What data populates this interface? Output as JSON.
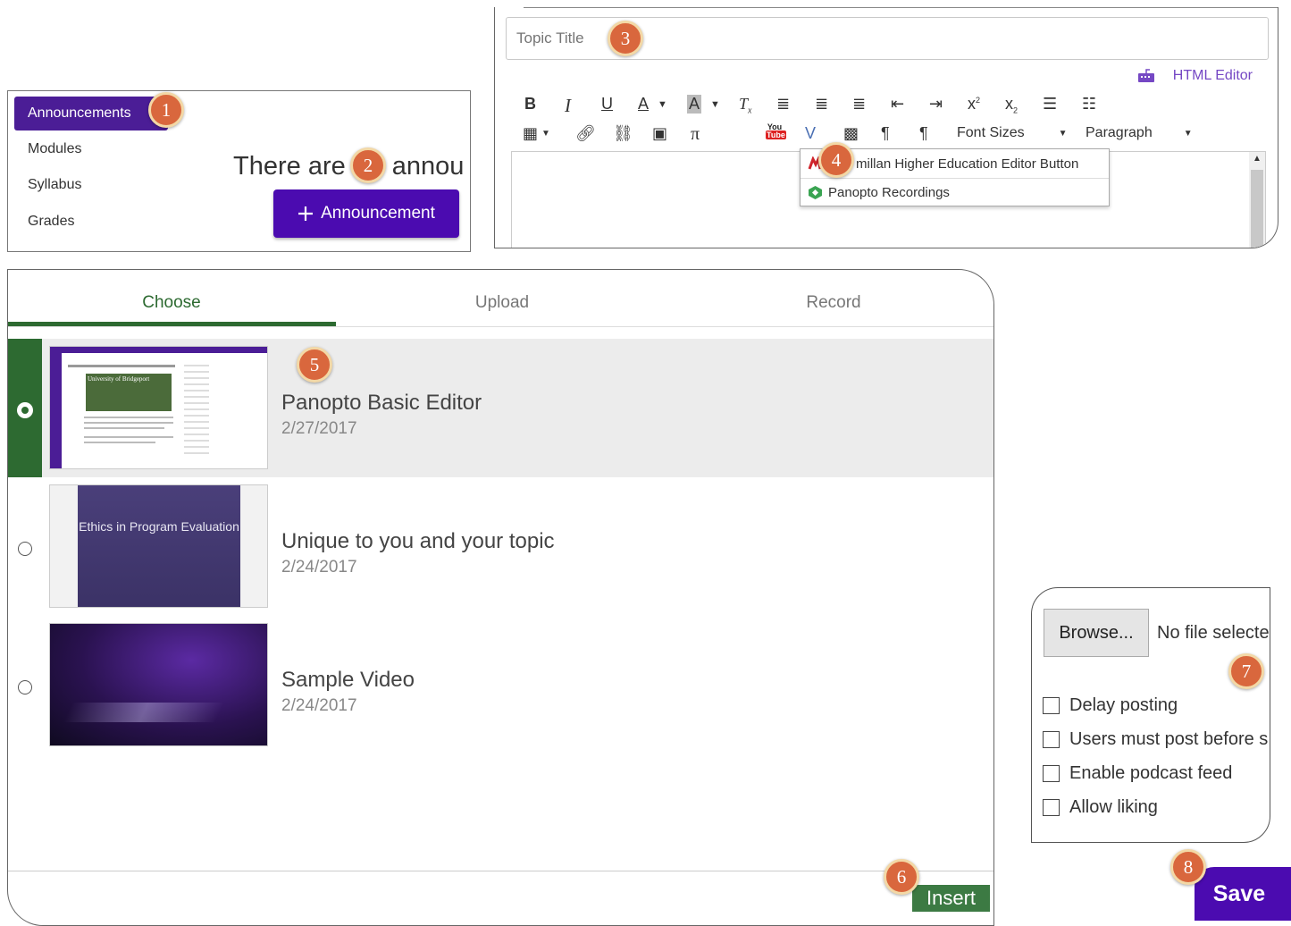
{
  "nav": {
    "items": [
      {
        "label": "Announcements",
        "active": true
      },
      {
        "label": "Modules"
      },
      {
        "label": "Syllabus"
      },
      {
        "label": "Grades"
      }
    ],
    "message": "There are",
    "message_tail": "annou",
    "add_button": {
      "icon": "plus",
      "label": "Announcement"
    }
  },
  "editor": {
    "topic_placeholder": "Topic Title",
    "html_editor_label": "HTML Editor",
    "font_sizes_label": "Font Sizes",
    "paragraph_label": "Paragraph",
    "youtube_label_top": "You",
    "youtube_label_bottom": "Tube",
    "dropdown": [
      {
        "label": "millan Higher Education Editor Button"
      },
      {
        "label": "Panopto Recordings"
      }
    ]
  },
  "chooser": {
    "tabs": [
      {
        "label": "Choose",
        "active": true
      },
      {
        "label": "Upload"
      },
      {
        "label": "Record"
      }
    ],
    "videos": [
      {
        "title": "Panopto Basic Editor",
        "date": "2/27/2017",
        "selected": true,
        "thumb_caption": "University of Bridgeport"
      },
      {
        "title": "Unique to you and your topic",
        "date": "2/24/2017",
        "thumb_caption": "Ethics in Program Evaluation"
      },
      {
        "title": "Sample Video",
        "date": "2/24/2017"
      }
    ],
    "insert_label": "Insert"
  },
  "options": {
    "browse_label": "Browse...",
    "no_file": "No file selecte",
    "checkboxes": [
      {
        "label": "Delay posting"
      },
      {
        "label": "Users must post before s"
      },
      {
        "label": "Enable podcast feed"
      },
      {
        "label": "Allow liking"
      }
    ]
  },
  "save_label": "Save",
  "callouts": [
    "1",
    "2",
    "3",
    "4",
    "5",
    "6",
    "7",
    "8"
  ],
  "colors": {
    "purple": "#4b0bb0",
    "green": "#2d6a31",
    "badge": "#d9673d",
    "link_purple": "#7548c4"
  }
}
